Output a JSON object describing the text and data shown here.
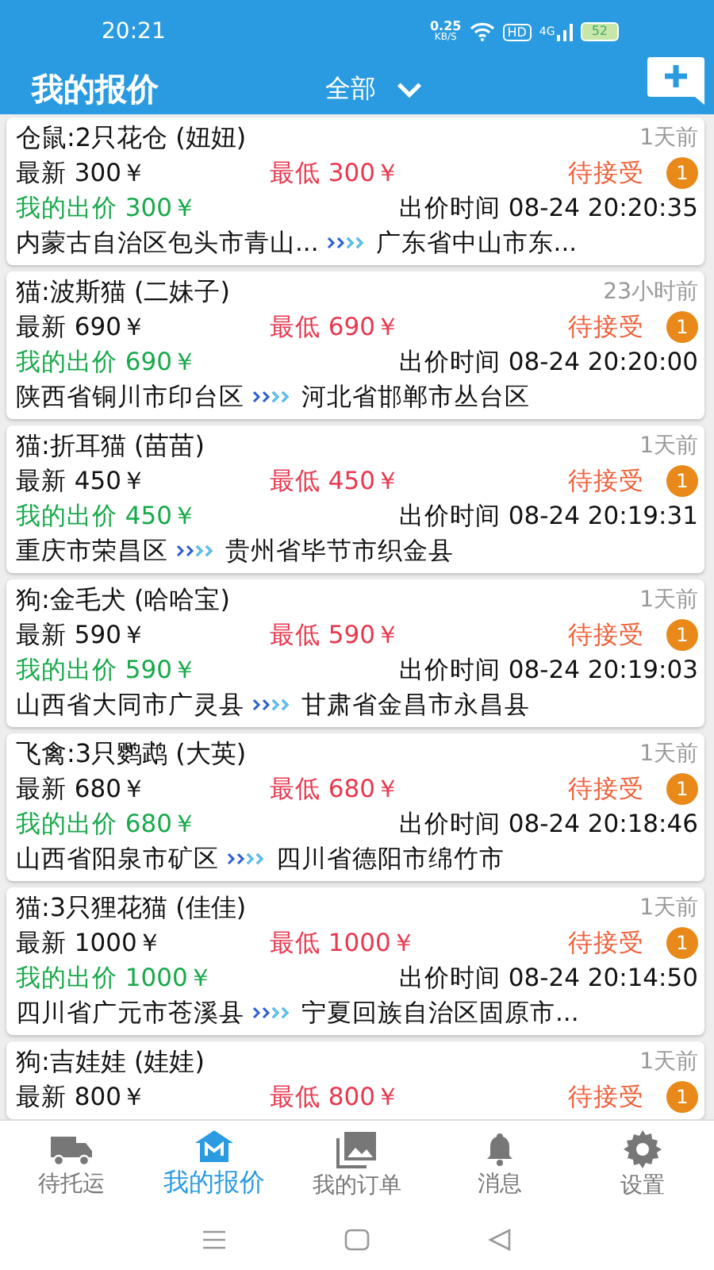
{
  "status_bar": {
    "time": "20:21",
    "net_speed": "0.25",
    "net_unit": "KB/S",
    "hd": "HD",
    "network": "4G",
    "battery": "52"
  },
  "header": {
    "title": "我的报价",
    "filter": "全部"
  },
  "offers": [
    {
      "title": "仓鼠:2只花仓 (妞妞)",
      "age": "1天前",
      "latest": "最新 300￥",
      "lowest": "最低 300￥",
      "status": "待接受",
      "badge": "1",
      "my_price": "我的出价 300￥",
      "time": "出价时间 08-24 20:20:35",
      "from": "内蒙古自治区包头市青山...",
      "to": "广东省中山市东..."
    },
    {
      "title": "猫:波斯猫 (二妹子)",
      "age": "23小时前",
      "latest": "最新 690￥",
      "lowest": "最低 690￥",
      "status": "待接受",
      "badge": "1",
      "my_price": "我的出价 690￥",
      "time": "出价时间 08-24 20:20:00",
      "from": "陕西省铜川市印台区",
      "to": "河北省邯郸市丛台区"
    },
    {
      "title": "猫:折耳猫 (苗苗)",
      "age": "1天前",
      "latest": "最新 450￥",
      "lowest": "最低 450￥",
      "status": "待接受",
      "badge": "1",
      "my_price": "我的出价 450￥",
      "time": "出价时间 08-24 20:19:31",
      "from": "重庆市荣昌区",
      "to": "贵州省毕节市织金县"
    },
    {
      "title": "狗:金毛犬 (哈哈宝)",
      "age": "1天前",
      "latest": "最新 590￥",
      "lowest": "最低 590￥",
      "status": "待接受",
      "badge": "1",
      "my_price": "我的出价 590￥",
      "time": "出价时间 08-24 20:19:03",
      "from": "山西省大同市广灵县",
      "to": "甘肃省金昌市永昌县"
    },
    {
      "title": "飞禽:3只鹦鹉 (大英)",
      "age": "1天前",
      "latest": "最新 680￥",
      "lowest": "最低 680￥",
      "status": "待接受",
      "badge": "1",
      "my_price": "我的出价 680￥",
      "time": "出价时间 08-24 20:18:46",
      "from": "山西省阳泉市矿区",
      "to": "四川省德阳市绵竹市"
    },
    {
      "title": "猫:3只狸花猫 (佳佳)",
      "age": "1天前",
      "latest": "最新 1000￥",
      "lowest": "最低 1000￥",
      "status": "待接受",
      "badge": "1",
      "my_price": "我的出价 1000￥",
      "time": "出价时间 08-24 20:14:50",
      "from": "四川省广元市苍溪县",
      "to": "宁夏回族自治区固原市..."
    },
    {
      "title": "狗:吉娃娃 (娃娃)",
      "age": "1天前",
      "latest": "最新 800￥",
      "lowest": "最低 800￥",
      "status": "待接受",
      "badge": "1"
    }
  ],
  "tabs": [
    {
      "kind": "truck",
      "label": "待托运",
      "selected": false
    },
    {
      "kind": "home",
      "label": "我的报价",
      "selected": true
    },
    {
      "kind": "gallery",
      "label": "我的订单",
      "selected": false
    },
    {
      "kind": "bell",
      "label": "消息",
      "selected": false
    },
    {
      "kind": "gear",
      "label": "设置",
      "selected": false
    }
  ]
}
